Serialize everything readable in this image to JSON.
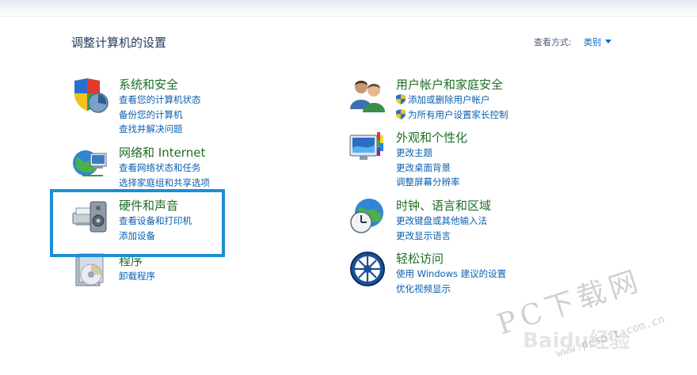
{
  "page_title": "调整计算机的设置",
  "view_by": {
    "label": "查看方式:",
    "value": "类别"
  },
  "categories": [
    {
      "title": "系统和安全",
      "icon": "system-security-icon",
      "links": [
        "查看您的计算机状态",
        "备份您的计算机",
        "查找并解决问题"
      ]
    },
    {
      "title": "网络和 Internet",
      "icon": "network-internet-icon",
      "links": [
        "查看网络状态和任务",
        "选择家庭组和共享选项"
      ]
    },
    {
      "title": "硬件和声音",
      "icon": "hardware-sound-icon",
      "links": [
        "查看设备和打印机",
        "添加设备"
      ]
    },
    {
      "title": "程序",
      "icon": "programs-icon",
      "links": [
        "卸载程序"
      ]
    },
    {
      "title": "用户帐户和家庭安全",
      "icon": "user-accounts-icon",
      "links": [
        "添加或删除用户帐户",
        "为所有用户设置家长控制"
      ]
    },
    {
      "title": "外观和个性化",
      "icon": "appearance-icon",
      "links": [
        "更改主题",
        "更改桌面背景",
        "调整屏幕分辨率"
      ]
    },
    {
      "title": "时钟、语言和区域",
      "icon": "clock-language-icon",
      "links": [
        "更改键盘或其他输入法",
        "更改显示语言"
      ]
    },
    {
      "title": "轻松访问",
      "icon": "ease-of-access-icon",
      "links": [
        "使用 Windows 建议的设置",
        "优化视频显示"
      ]
    }
  ],
  "watermark": {
    "site_name": "PC下载网",
    "url": "www.pcsoft.com.cn",
    "baidu": "Baidu经验"
  },
  "colors": {
    "title_green": "#1e6e25",
    "link_blue": "#0b5fb0",
    "highlight": "#1b8fd6"
  }
}
